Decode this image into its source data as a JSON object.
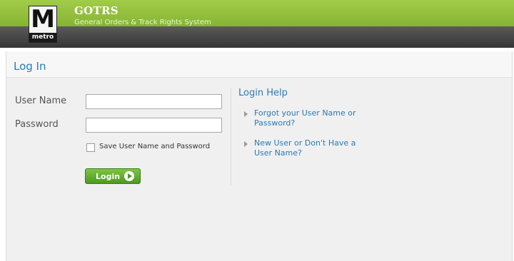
{
  "header": {
    "logo_letter": "M",
    "logo_sub": "metro",
    "app_name": "GOTRS",
    "app_subtitle": "General Orders & Track Rights System"
  },
  "login_panel": {
    "title": "Log In",
    "username_label": "User Name",
    "username_value": "",
    "password_label": "Password",
    "password_value": "",
    "save_checkbox_label": "Save User Name and Password",
    "save_checked": false,
    "login_button": "Login"
  },
  "help": {
    "title": "Login Help",
    "links": [
      "Forgot your User Name or Password?",
      "New User or Don't Have a User Name?"
    ]
  },
  "colors": {
    "accent": "#2a7ab8",
    "header_green": "#8fbf3a",
    "button_green": "#4a9a1f"
  }
}
